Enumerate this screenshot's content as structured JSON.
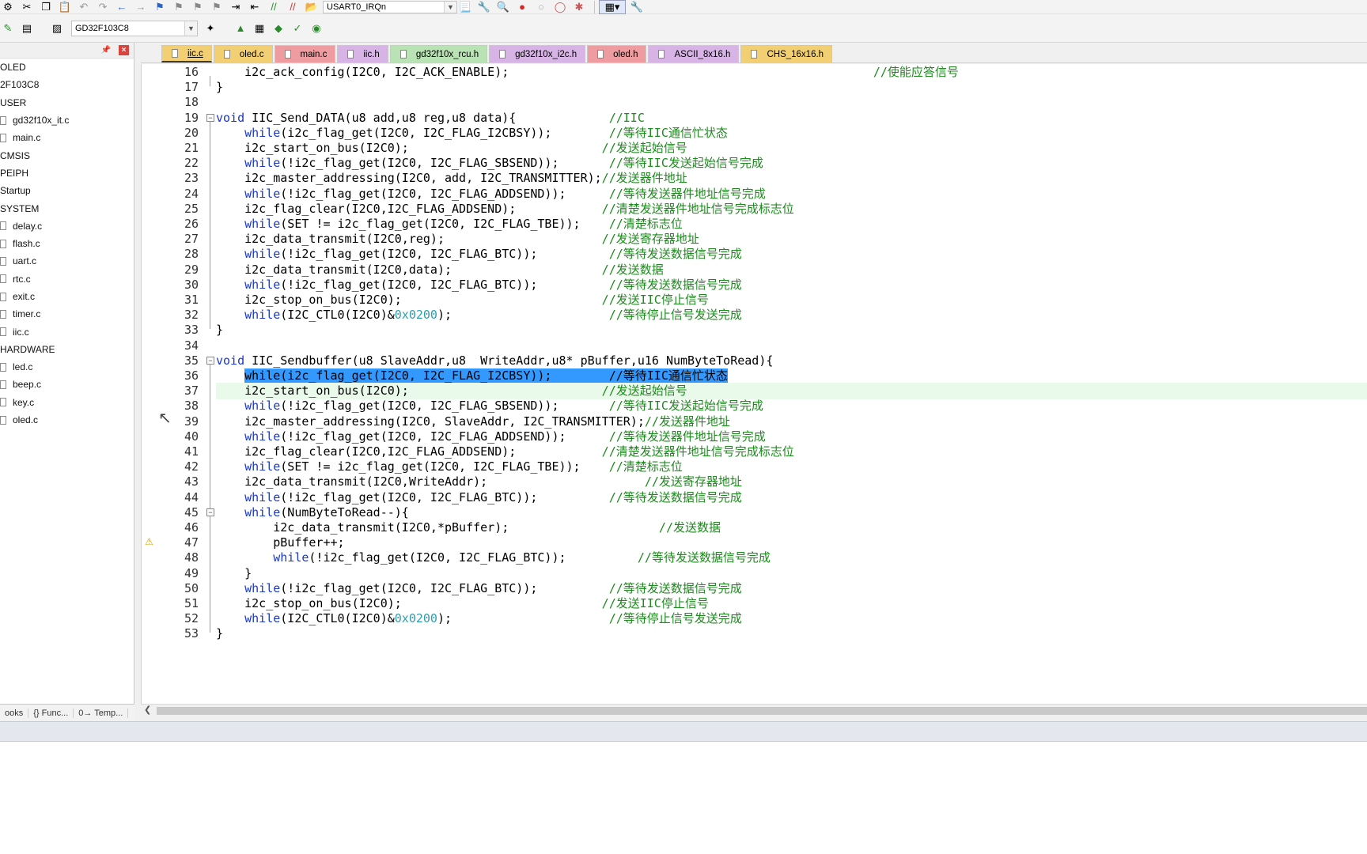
{
  "toolbar": {
    "function_combo": "USART0_IRQn",
    "target_combo": "GD32F103C8"
  },
  "project": {
    "items": [
      {
        "label": "OLED",
        "kind": "group"
      },
      {
        "label": "2F103C8",
        "kind": "group"
      },
      {
        "label": "USER",
        "kind": "group"
      },
      {
        "label": "gd32f10x_it.c",
        "kind": "file"
      },
      {
        "label": "main.c",
        "kind": "file"
      },
      {
        "label": "CMSIS",
        "kind": "group"
      },
      {
        "label": "PEIPH",
        "kind": "group"
      },
      {
        "label": "Startup",
        "kind": "group"
      },
      {
        "label": "SYSTEM",
        "kind": "group"
      },
      {
        "label": "delay.c",
        "kind": "file"
      },
      {
        "label": "flash.c",
        "kind": "file"
      },
      {
        "label": "uart.c",
        "kind": "file"
      },
      {
        "label": "rtc.c",
        "kind": "file"
      },
      {
        "label": "exit.c",
        "kind": "file"
      },
      {
        "label": "timer.c",
        "kind": "file"
      },
      {
        "label": "iic.c",
        "kind": "file"
      },
      {
        "label": "HARDWARE",
        "kind": "group"
      },
      {
        "label": "led.c",
        "kind": "file"
      },
      {
        "label": "beep.c",
        "kind": "file"
      },
      {
        "label": "key.c",
        "kind": "file"
      },
      {
        "label": "oled.c",
        "kind": "file"
      }
    ],
    "bottom_tabs": [
      "ooks",
      "{} Func...",
      "0→ Temp..."
    ]
  },
  "tabs": [
    {
      "label": "iic.c",
      "color": "#f2cf73",
      "active": true
    },
    {
      "label": "oled.c",
      "color": "#f2cf73",
      "active": false
    },
    {
      "label": "main.c",
      "color": "#ee9ca0",
      "active": false
    },
    {
      "label": "iic.h",
      "color": "#d7b3e6",
      "active": false
    },
    {
      "label": "gd32f10x_rcu.h",
      "color": "#b9e3b4",
      "active": false
    },
    {
      "label": "gd32f10x_i2c.h",
      "color": "#d7b3e6",
      "active": false
    },
    {
      "label": "oled.h",
      "color": "#ee9ca0",
      "active": false
    },
    {
      "label": "ASCII_8x16.h",
      "color": "#d7b3e6",
      "active": false
    },
    {
      "label": "CHS_16x16.h",
      "color": "#f2cf73",
      "active": false
    }
  ],
  "code_lines": [
    {
      "n": "16",
      "segs": [
        [
          "    i2c_ack_config(I2C0, I2C_ACK_ENABLE);                                                   ",
          ""
        ],
        [
          "//使能应答信号",
          "cm"
        ]
      ]
    },
    {
      "n": "17",
      "segs": [
        [
          "}",
          ""
        ]
      ]
    },
    {
      "n": "18",
      "segs": [
        [
          "",
          ""
        ]
      ]
    },
    {
      "n": "19",
      "segs": [
        [
          "void",
          "kw"
        ],
        [
          " IIC_Send_DATA(u8 add,u8 reg,u8 data){             ",
          ""
        ],
        [
          "//IIC",
          "cm"
        ]
      ]
    },
    {
      "n": "20",
      "segs": [
        [
          "    ",
          ""
        ],
        [
          "while",
          "kw"
        ],
        [
          "(i2c_flag_get(I2C0, I2C_FLAG_I2CBSY));        ",
          ""
        ],
        [
          "//等待IIC通信忙状态",
          "cm"
        ]
      ]
    },
    {
      "n": "21",
      "segs": [
        [
          "    i2c_start_on_bus(I2C0);                           ",
          ""
        ],
        [
          "//发送起始信号",
          "cm"
        ]
      ]
    },
    {
      "n": "22",
      "segs": [
        [
          "    ",
          ""
        ],
        [
          "while",
          "kw"
        ],
        [
          "(!i2c_flag_get(I2C0, I2C_FLAG_SBSEND));       ",
          ""
        ],
        [
          "//等待IIC发送起始信号完成",
          "cm"
        ]
      ]
    },
    {
      "n": "23",
      "segs": [
        [
          "    i2c_master_addressing(I2C0, add, I2C_TRANSMITTER);",
          ""
        ],
        [
          "//发送器件地址",
          "cm"
        ]
      ]
    },
    {
      "n": "24",
      "segs": [
        [
          "    ",
          ""
        ],
        [
          "while",
          "kw"
        ],
        [
          "(!i2c_flag_get(I2C0, I2C_FLAG_ADDSEND));      ",
          ""
        ],
        [
          "//等待发送器件地址信号完成",
          "cm"
        ]
      ]
    },
    {
      "n": "25",
      "segs": [
        [
          "    i2c_flag_clear(I2C0,I2C_FLAG_ADDSEND);            ",
          ""
        ],
        [
          "//清楚发送器件地址信号完成标志位",
          "cm"
        ]
      ]
    },
    {
      "n": "26",
      "segs": [
        [
          "    ",
          ""
        ],
        [
          "while",
          "kw"
        ],
        [
          "(SET != i2c_flag_get(I2C0, I2C_FLAG_TBE));    ",
          ""
        ],
        [
          "//清楚标志位",
          "cm"
        ]
      ]
    },
    {
      "n": "27",
      "segs": [
        [
          "    i2c_data_transmit(I2C0,reg);                      ",
          ""
        ],
        [
          "//发送寄存器地址",
          "cm"
        ]
      ]
    },
    {
      "n": "28",
      "segs": [
        [
          "    ",
          ""
        ],
        [
          "while",
          "kw"
        ],
        [
          "(!i2c_flag_get(I2C0, I2C_FLAG_BTC));          ",
          ""
        ],
        [
          "//等待发送数据信号完成",
          "cm"
        ]
      ]
    },
    {
      "n": "29",
      "segs": [
        [
          "    i2c_data_transmit(I2C0,data);                     ",
          ""
        ],
        [
          "//发送数据",
          "cm"
        ]
      ]
    },
    {
      "n": "30",
      "segs": [
        [
          "    ",
          ""
        ],
        [
          "while",
          "kw"
        ],
        [
          "(!i2c_flag_get(I2C0, I2C_FLAG_BTC));          ",
          ""
        ],
        [
          "//等待发送数据信号完成",
          "cm"
        ]
      ]
    },
    {
      "n": "31",
      "segs": [
        [
          "    i2c_stop_on_bus(I2C0);                            ",
          ""
        ],
        [
          "//发送IIC停止信号",
          "cm"
        ]
      ]
    },
    {
      "n": "32",
      "segs": [
        [
          "    ",
          ""
        ],
        [
          "while",
          "kw"
        ],
        [
          "(I2C_CTL0(I2C0)&",
          ""
        ],
        [
          "0x0200",
          "num"
        ],
        [
          ");                      ",
          ""
        ],
        [
          "//等待停止信号发送完成",
          "cm"
        ]
      ]
    },
    {
      "n": "33",
      "segs": [
        [
          "}",
          ""
        ]
      ]
    },
    {
      "n": "34",
      "segs": [
        [
          "",
          ""
        ]
      ]
    },
    {
      "n": "35",
      "segs": [
        [
          "void",
          "kw"
        ],
        [
          " IIC_Sendbuffer(u8 SlaveAddr,u8  WriteAddr,u8* pBuffer,u16 NumByteToRead){",
          ""
        ]
      ]
    },
    {
      "n": "36",
      "sel": true,
      "segs": [
        [
          "    ",
          ""
        ],
        [
          "while(i2c_flag_get(I2C0, I2C_FLAG_I2CBSY));        //等待IIC通信忙状态",
          "sel"
        ]
      ]
    },
    {
      "n": "37",
      "cur": true,
      "segs": [
        [
          "    i2c_start_on_bus(I2C0);                           ",
          ""
        ],
        [
          "//发送起始信号",
          "cm"
        ]
      ]
    },
    {
      "n": "38",
      "segs": [
        [
          "    ",
          ""
        ],
        [
          "while",
          "kw"
        ],
        [
          "(!i2c_flag_get(I2C0, I2C_FLAG_SBSEND));       ",
          ""
        ],
        [
          "//等待IIC发送起始信号完成",
          "cm"
        ]
      ]
    },
    {
      "n": "39",
      "segs": [
        [
          "    i2c_master_addressing(I2C0, SlaveAddr, I2C_TRANSMITTER);",
          ""
        ],
        [
          "//发送器件地址",
          "cm"
        ]
      ]
    },
    {
      "n": "40",
      "segs": [
        [
          "    ",
          ""
        ],
        [
          "while",
          "kw"
        ],
        [
          "(!i2c_flag_get(I2C0, I2C_FLAG_ADDSEND));      ",
          ""
        ],
        [
          "//等待发送器件地址信号完成",
          "cm"
        ]
      ]
    },
    {
      "n": "41",
      "segs": [
        [
          "    i2c_flag_clear(I2C0,I2C_FLAG_ADDSEND);            ",
          ""
        ],
        [
          "//清楚发送器件地址信号完成标志位",
          "cm"
        ]
      ]
    },
    {
      "n": "42",
      "segs": [
        [
          "    ",
          ""
        ],
        [
          "while",
          "kw"
        ],
        [
          "(SET != i2c_flag_get(I2C0, I2C_FLAG_TBE));    ",
          ""
        ],
        [
          "//清楚标志位",
          "cm"
        ]
      ]
    },
    {
      "n": "43",
      "segs": [
        [
          "    i2c_data_transmit(I2C0,WriteAddr);                      ",
          ""
        ],
        [
          "//发送寄存器地址",
          "cm"
        ]
      ]
    },
    {
      "n": "44",
      "segs": [
        [
          "    ",
          ""
        ],
        [
          "while",
          "kw"
        ],
        [
          "(!i2c_flag_get(I2C0, I2C_FLAG_BTC));          ",
          ""
        ],
        [
          "//等待发送数据信号完成",
          "cm"
        ]
      ]
    },
    {
      "n": "45",
      "segs": [
        [
          "    ",
          ""
        ],
        [
          "while",
          "kw"
        ],
        [
          "(NumByteToRead--){",
          ""
        ]
      ]
    },
    {
      "n": "46",
      "segs": [
        [
          "        i2c_data_transmit(I2C0,*pBuffer);                     ",
          ""
        ],
        [
          "//发送数据",
          "cm"
        ]
      ]
    },
    {
      "n": "47",
      "segs": [
        [
          "        pBuffer++;",
          ""
        ]
      ]
    },
    {
      "n": "48",
      "segs": [
        [
          "        ",
          ""
        ],
        [
          "while",
          "kw"
        ],
        [
          "(!i2c_flag_get(I2C0, I2C_FLAG_BTC));          ",
          ""
        ],
        [
          "//等待发送数据信号完成",
          "cm"
        ]
      ]
    },
    {
      "n": "49",
      "segs": [
        [
          "    }",
          ""
        ]
      ]
    },
    {
      "n": "50",
      "segs": [
        [
          "    ",
          ""
        ],
        [
          "while",
          "kw"
        ],
        [
          "(!i2c_flag_get(I2C0, I2C_FLAG_BTC));          ",
          ""
        ],
        [
          "//等待发送数据信号完成",
          "cm"
        ]
      ]
    },
    {
      "n": "51",
      "segs": [
        [
          "    i2c_stop_on_bus(I2C0);                            ",
          ""
        ],
        [
          "//发送IIC停止信号",
          "cm"
        ]
      ]
    },
    {
      "n": "52",
      "segs": [
        [
          "    ",
          ""
        ],
        [
          "while",
          "kw"
        ],
        [
          "(I2C_CTL0(I2C0)&",
          ""
        ],
        [
          "0x0200",
          "num"
        ],
        [
          ");                      ",
          ""
        ],
        [
          "//等待停止信号发送完成",
          "cm"
        ]
      ]
    },
    {
      "n": "53",
      "segs": [
        [
          "}",
          ""
        ]
      ]
    }
  ],
  "colors": {
    "keyword": "#1a37c8",
    "comment": "#1c8a1c",
    "number": "#2a9fb0",
    "selection": "#3399ff",
    "current_line": "#eafaea"
  }
}
